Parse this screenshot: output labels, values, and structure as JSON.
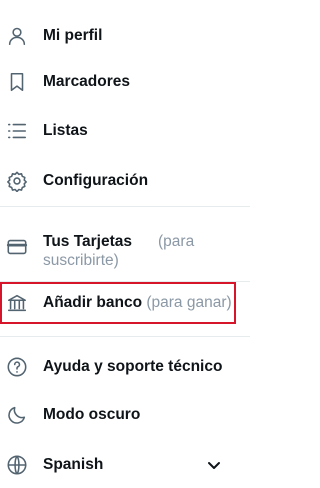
{
  "menu": {
    "profile": {
      "label": "Mi perfil",
      "icon": "person-icon"
    },
    "bookmarks": {
      "label": "Marcadores",
      "icon": "bookmark-icon"
    },
    "lists": {
      "label": "Listas",
      "icon": "list-icon"
    },
    "settings": {
      "label": "Configuración",
      "icon": "gear-icon"
    },
    "cards": {
      "label": "Tus Tarjetas",
      "hint": "(para suscribirte)",
      "icon": "credit-card-icon"
    },
    "add_bank": {
      "label": "Añadir banco",
      "hint": "(para ganar)",
      "icon": "bank-icon"
    },
    "help": {
      "label": "Ayuda y soporte técnico",
      "icon": "question-icon"
    },
    "dark_mode": {
      "label": "Modo oscuro",
      "icon": "moon-icon"
    },
    "language": {
      "label": "Spanish",
      "icon": "globe-icon"
    }
  },
  "colors": {
    "highlight_border": "#d6152a",
    "text": "#0f1419",
    "hint": "#8b98a5",
    "icon": "#536471"
  }
}
